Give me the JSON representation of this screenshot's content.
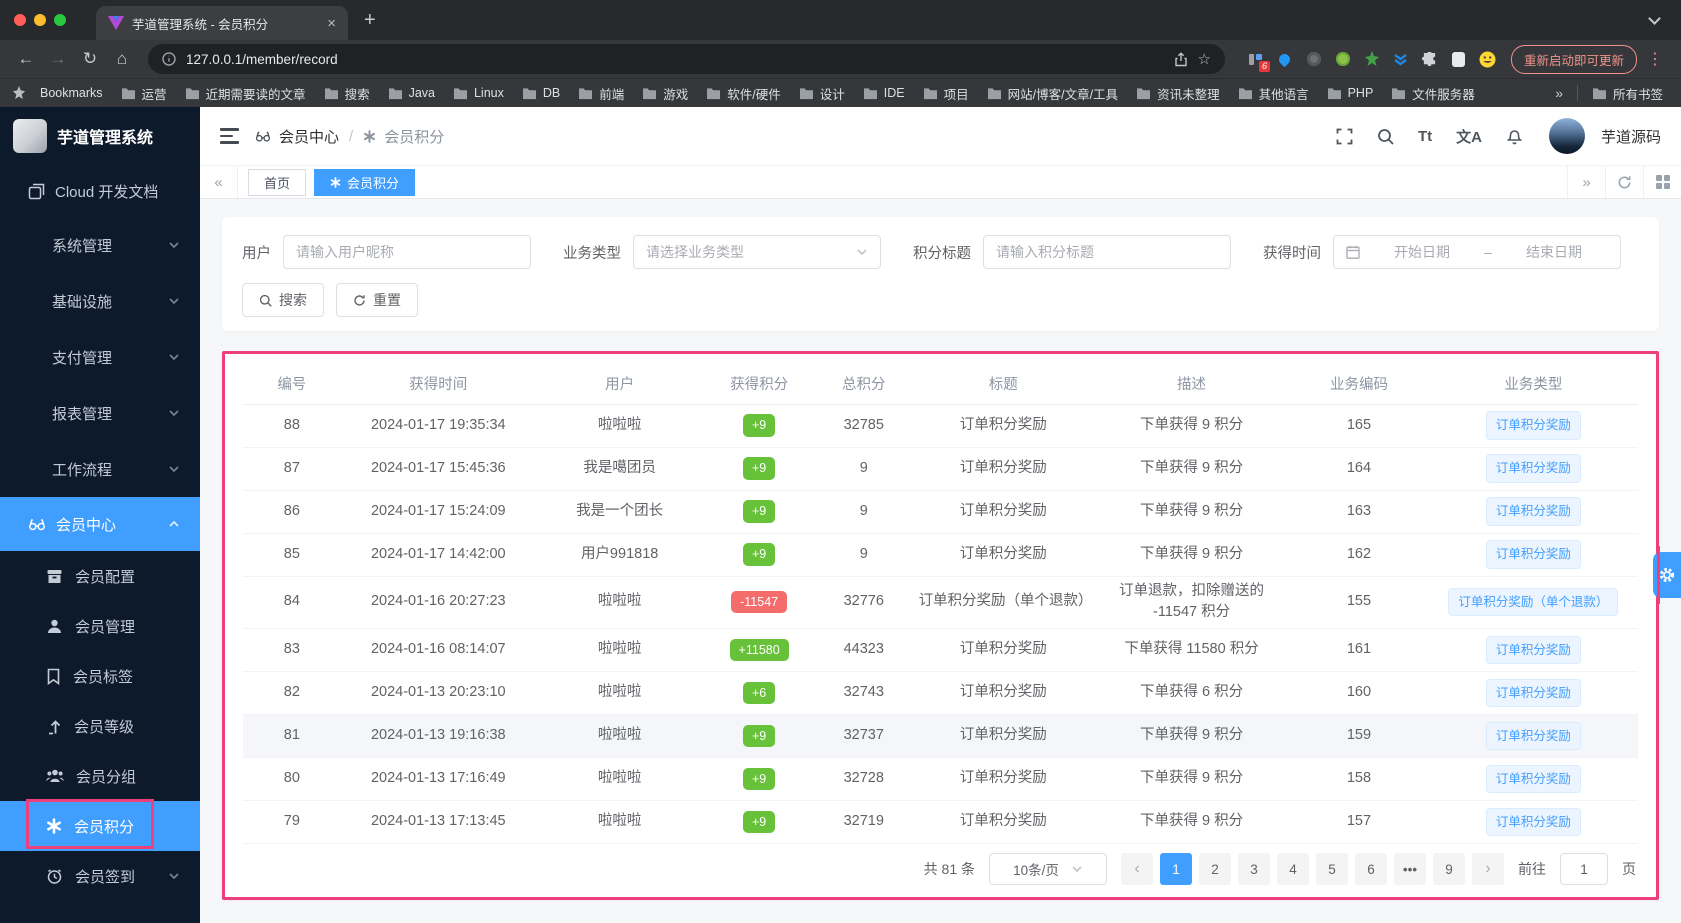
{
  "colors": {
    "accent": "#409eff",
    "positive": "#67c23a",
    "negative": "#f56c6c",
    "annotation": "#ed3f7c"
  },
  "glyphs": {
    "close": "×",
    "new_tab": "+",
    "back": "←",
    "forward": "→",
    "reload": "↻",
    "home": "⌂",
    "star": "☆",
    "kebab": "⋮",
    "overflow": "»",
    "collapse": "«",
    "expand": "»",
    "prev": "‹",
    "next": "›"
  },
  "browser": {
    "tab_title": "芋道管理系统 - 会员积分",
    "url": "127.0.0.1/member/record",
    "ext_badge": "6",
    "update_button": "重新启动即可更新",
    "bookmarks_bar": {
      "label": "Bookmarks",
      "folders": [
        "运营",
        "近期需要读的文章",
        "搜索",
        "Java",
        "Linux",
        "DB",
        "前端",
        "游戏",
        "软件/硬件",
        "设计",
        "IDE",
        "项目",
        "网站/博客/文章/工具",
        "资讯未整理",
        "其他语言",
        "PHP",
        "文件服务器"
      ],
      "all_bookmarks": "所有书签"
    }
  },
  "sidebar": {
    "app_title": "芋道管理系统",
    "doc_label": "Cloud 开发文档",
    "groups": [
      "系统管理",
      "基础设施",
      "支付管理",
      "报表管理",
      "工作流程"
    ],
    "member_center": "会员中心",
    "children": [
      "会员配置",
      "会员管理",
      "会员标签",
      "会员等级",
      "会员分组",
      "会员积分",
      "会员签到"
    ]
  },
  "header": {
    "breadcrumb": [
      "会员中心",
      "会员积分"
    ],
    "separator": "/",
    "font_icon": "Tt",
    "locale_icon": "文A",
    "username": "芋道源码"
  },
  "tabs": {
    "items": [
      {
        "label": "首页",
        "active": false
      },
      {
        "label": "会员积分",
        "active": true
      }
    ]
  },
  "filters": {
    "user": {
      "label": "用户",
      "placeholder": "请输入用户昵称"
    },
    "biz_type": {
      "label": "业务类型",
      "placeholder": "请选择业务类型"
    },
    "title": {
      "label": "积分标题",
      "placeholder": "请输入积分标题"
    },
    "time": {
      "label": "获得时间",
      "start": "开始日期",
      "separator": "–",
      "end": "结束日期"
    },
    "search": "搜索",
    "reset": "重置"
  },
  "table": {
    "columns": [
      "编号",
      "获得时间",
      "用户",
      "获得积分",
      "总积分",
      "标题",
      "描述",
      "业务编码",
      "业务类型"
    ],
    "rows": [
      {
        "id": "88",
        "time": "2024-01-17 19:35:34",
        "user": "啦啦啦",
        "points": "+9",
        "total": "32785",
        "title": "订单积分奖励",
        "desc": "下单获得 9 积分",
        "biz_id": "165",
        "biz_type": "订单积分奖励"
      },
      {
        "id": "87",
        "time": "2024-01-17 15:45:36",
        "user": "我是噶团员",
        "points": "+9",
        "total": "9",
        "title": "订单积分奖励",
        "desc": "下单获得 9 积分",
        "biz_id": "164",
        "biz_type": "订单积分奖励"
      },
      {
        "id": "86",
        "time": "2024-01-17 15:24:09",
        "user": "我是一个团长",
        "points": "+9",
        "total": "9",
        "title": "订单积分奖励",
        "desc": "下单获得 9 积分",
        "biz_id": "163",
        "biz_type": "订单积分奖励"
      },
      {
        "id": "85",
        "time": "2024-01-17 14:42:00",
        "user": "用户991818",
        "points": "+9",
        "total": "9",
        "title": "订单积分奖励",
        "desc": "下单获得 9 积分",
        "biz_id": "162",
        "biz_type": "订单积分奖励"
      },
      {
        "id": "84",
        "time": "2024-01-16 20:27:23",
        "user": "啦啦啦",
        "points": "-11547",
        "neg": true,
        "total": "32776",
        "title": "订单积分奖励（单个退款）",
        "desc": "订单退款，扣除赠送的 -11547 积分",
        "biz_id": "155",
        "biz_type": "订单积分奖励（单个退款）"
      },
      {
        "id": "83",
        "time": "2024-01-16 08:14:07",
        "user": "啦啦啦",
        "points": "+11580",
        "total": "44323",
        "title": "订单积分奖励",
        "desc": "下单获得 11580 积分",
        "biz_id": "161",
        "biz_type": "订单积分奖励"
      },
      {
        "id": "82",
        "time": "2024-01-13 20:23:10",
        "user": "啦啦啦",
        "points": "+6",
        "total": "32743",
        "title": "订单积分奖励",
        "desc": "下单获得 6 积分",
        "biz_id": "160",
        "biz_type": "订单积分奖励"
      },
      {
        "id": "81",
        "time": "2024-01-13 19:16:38",
        "user": "啦啦啦",
        "points": "+9",
        "total": "32737",
        "title": "订单积分奖励",
        "desc": "下单获得 9 积分",
        "biz_id": "159",
        "biz_type": "订单积分奖励",
        "hl": true
      },
      {
        "id": "80",
        "time": "2024-01-13 17:16:49",
        "user": "啦啦啦",
        "points": "+9",
        "total": "32728",
        "title": "订单积分奖励",
        "desc": "下单获得 9 积分",
        "biz_id": "158",
        "biz_type": "订单积分奖励"
      },
      {
        "id": "79",
        "time": "2024-01-13 17:13:45",
        "user": "啦啦啦",
        "points": "+9",
        "total": "32719",
        "title": "订单积分奖励",
        "desc": "下单获得 9 积分",
        "biz_id": "157",
        "biz_type": "订单积分奖励"
      }
    ]
  },
  "pagination": {
    "total": "共 81 条",
    "page_size": "10条/页",
    "pages": [
      {
        "label": "1",
        "active": true
      },
      {
        "label": "2"
      },
      {
        "label": "3"
      },
      {
        "label": "4"
      },
      {
        "label": "5"
      },
      {
        "label": "6"
      },
      {
        "label": "•••"
      },
      {
        "label": "9"
      }
    ],
    "goto_label": "前往",
    "goto_value": "1",
    "page_suffix": "页"
  }
}
